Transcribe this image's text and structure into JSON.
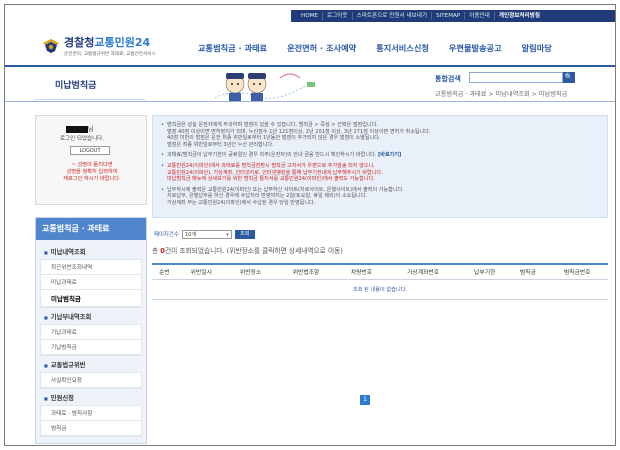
{
  "utility_bar": [
    "HOME",
    "로그아웃",
    "스마트폰으로 민원서 내보내기",
    "SITEMAP",
    "이용안내",
    "개인정보처리방침"
  ],
  "logo": {
    "title_prefix": "경찰청",
    "title_accent": "교통민원24",
    "subtitle": "운전면허, 교통법규위반 과태료, 교통안전서비스"
  },
  "gnb": [
    "교통범칙금 · 과태료",
    "운전면허 · 조사예약",
    "통지서비스신청",
    "우편물발송공고",
    "알림마당"
  ],
  "page_title": "미납범칙금",
  "search": {
    "label": "통합검색",
    "button": "🔍",
    "value": ""
  },
  "breadcrumb": "교통범칙금 · 과태료 > 미납내역조회 > 미납범칙금",
  "login": {
    "name_suffix": "님",
    "message": "로그인 되었습니다.",
    "logout_button": "LOGOUT",
    "note": "~ 성명이 틀리다면\n성명을 정확히 입력하여\n재로그인 하시기 바랍니다."
  },
  "sidebar": {
    "head": "교통범칙금 · 과태료",
    "sections": [
      {
        "label": "미납내역조회",
        "items": [
          {
            "label": "최근위반조회내역",
            "active": false
          },
          {
            "label": "미납과태료",
            "active": false
          },
          {
            "label": "미납범칙금",
            "active": true
          }
        ]
      },
      {
        "label": "기납부내역조회",
        "items": [
          {
            "label": "기납과태료",
            "active": false
          },
          {
            "label": "기납범칙금",
            "active": false
          }
        ]
      },
      {
        "label": "교통법규위반",
        "items": [
          {
            "label": "사실확인요청",
            "active": false
          }
        ]
      },
      {
        "label": "민원신청",
        "items": [
          {
            "label": "과태료 · 범칙사항",
            "active": false
          },
          {
            "label": "범칙금",
            "active": false
          }
        ]
      }
    ]
  },
  "notices": [
    {
      "text": "범칙금은 성실 운전자에게 부과하며 벌점이 있을 수 있습니다. 범칙금 > 즉심 > 선택은 벌점입니다.\n벌점 40점 이상이면 면허정지가 되며, 누산점수 1년 121점이상, 2년 201점 이상, 3년 271점 이상이면 면허가 취소됩니다.\n40점 미만의 벌점은 운전 최종 위반일로부터 1년동안 벌점이 추가되지 않은 경우 벌점이 소멸됩니다.\n벌점은 최종 위반일로부터 3년간 누산 관리합니다.",
      "red": false
    },
    {
      "text": "과태료/범칙금이 납부기한이 공휴일인 경우 차주(운전자)의 안내 금융 반드시 확인하시기 바랍니다.",
      "red": false,
      "link": "[바로가기]"
    },
    {
      "text": "교통민원24(이파인)에서 과태료를 범칙금전환시 범칙금 고지서가 우편으로 추가발송 되지 않으니,\n교통민원24(이파인), 가상계좌, 인터넷지로, 인터넷뱅킹을 통해 납부기한내에 납부해주시기 바랍니다.\n미납범칙금 메뉴에 상세보기를 위한 범칙금 통지서를 교통민원24(이파인)에서 출력도 가능합니다.",
      "red": true
    },
    {
      "text": "납부하시에 출력은 교통민원24(이파인) 또는 납부하신 사이트(지로사이트, 은행사이트)에서 출력이 가능합니다.\n지로납부, 은행납부를 하신 경우에 수납처리 반영까지는 2일(토요일, 휴일 제외)이 소요됩니다.\n가상계좌 부는 교통민원24(이파인)에서 수납된 경우 당일 반영됩니다.",
      "red": false
    }
  ],
  "controls": {
    "label": "페이지건수",
    "select_value": "10개",
    "button": "조회"
  },
  "result": {
    "prefix": "총 ",
    "count": "0",
    "suffix": "건이 조회되었습니다. (위반장소를 클릭하면 상세내역으로 이동)"
  },
  "table": {
    "headers": [
      "순번",
      "위반일시",
      "위반장소",
      "위반법조항",
      "차량번호",
      "가상계좌번호",
      "납부기한",
      "범칙금",
      "범칙금번호"
    ],
    "empty_message": "조회 된 내용이 없습니다."
  },
  "pager": {
    "current": "1"
  }
}
